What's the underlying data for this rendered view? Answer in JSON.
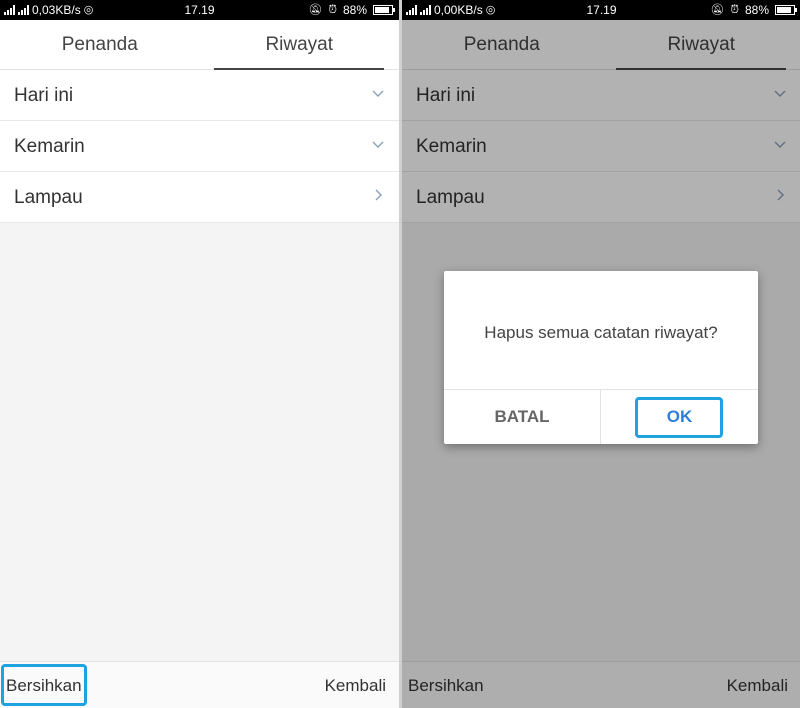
{
  "left": {
    "status": {
      "speed": "0,03KB/s",
      "time": "17.19",
      "battery": "88%",
      "battery_level": 0.88
    },
    "tabs": [
      {
        "label": "Penanda"
      },
      {
        "label": "Riwayat"
      }
    ],
    "list": [
      {
        "label": "Hari ini",
        "icon": "chevron-down-icon"
      },
      {
        "label": "Kemarin",
        "icon": "chevron-down-icon"
      },
      {
        "label": "Lampau",
        "icon": "chevron-right-icon"
      }
    ],
    "bottom": {
      "clear": "Bersihkan",
      "back": "Kembali"
    }
  },
  "right": {
    "status": {
      "speed": "0,00KB/s",
      "time": "17.19",
      "battery": "88%",
      "battery_level": 0.88
    },
    "tabs": [
      {
        "label": "Penanda"
      },
      {
        "label": "Riwayat"
      }
    ],
    "list": [
      {
        "label": "Hari ini",
        "icon": "chevron-down-icon"
      },
      {
        "label": "Kemarin",
        "icon": "chevron-down-icon"
      },
      {
        "label": "Lampau",
        "icon": "chevron-right-icon"
      }
    ],
    "bottom": {
      "clear": "Bersihkan",
      "back": "Kembali"
    },
    "dialog": {
      "message": "Hapus semua catatan riwayat?",
      "cancel": "BATAL",
      "ok": "OK"
    }
  },
  "colors": {
    "highlight": "#1ea3e0",
    "ok_text": "#2f7fd8"
  }
}
